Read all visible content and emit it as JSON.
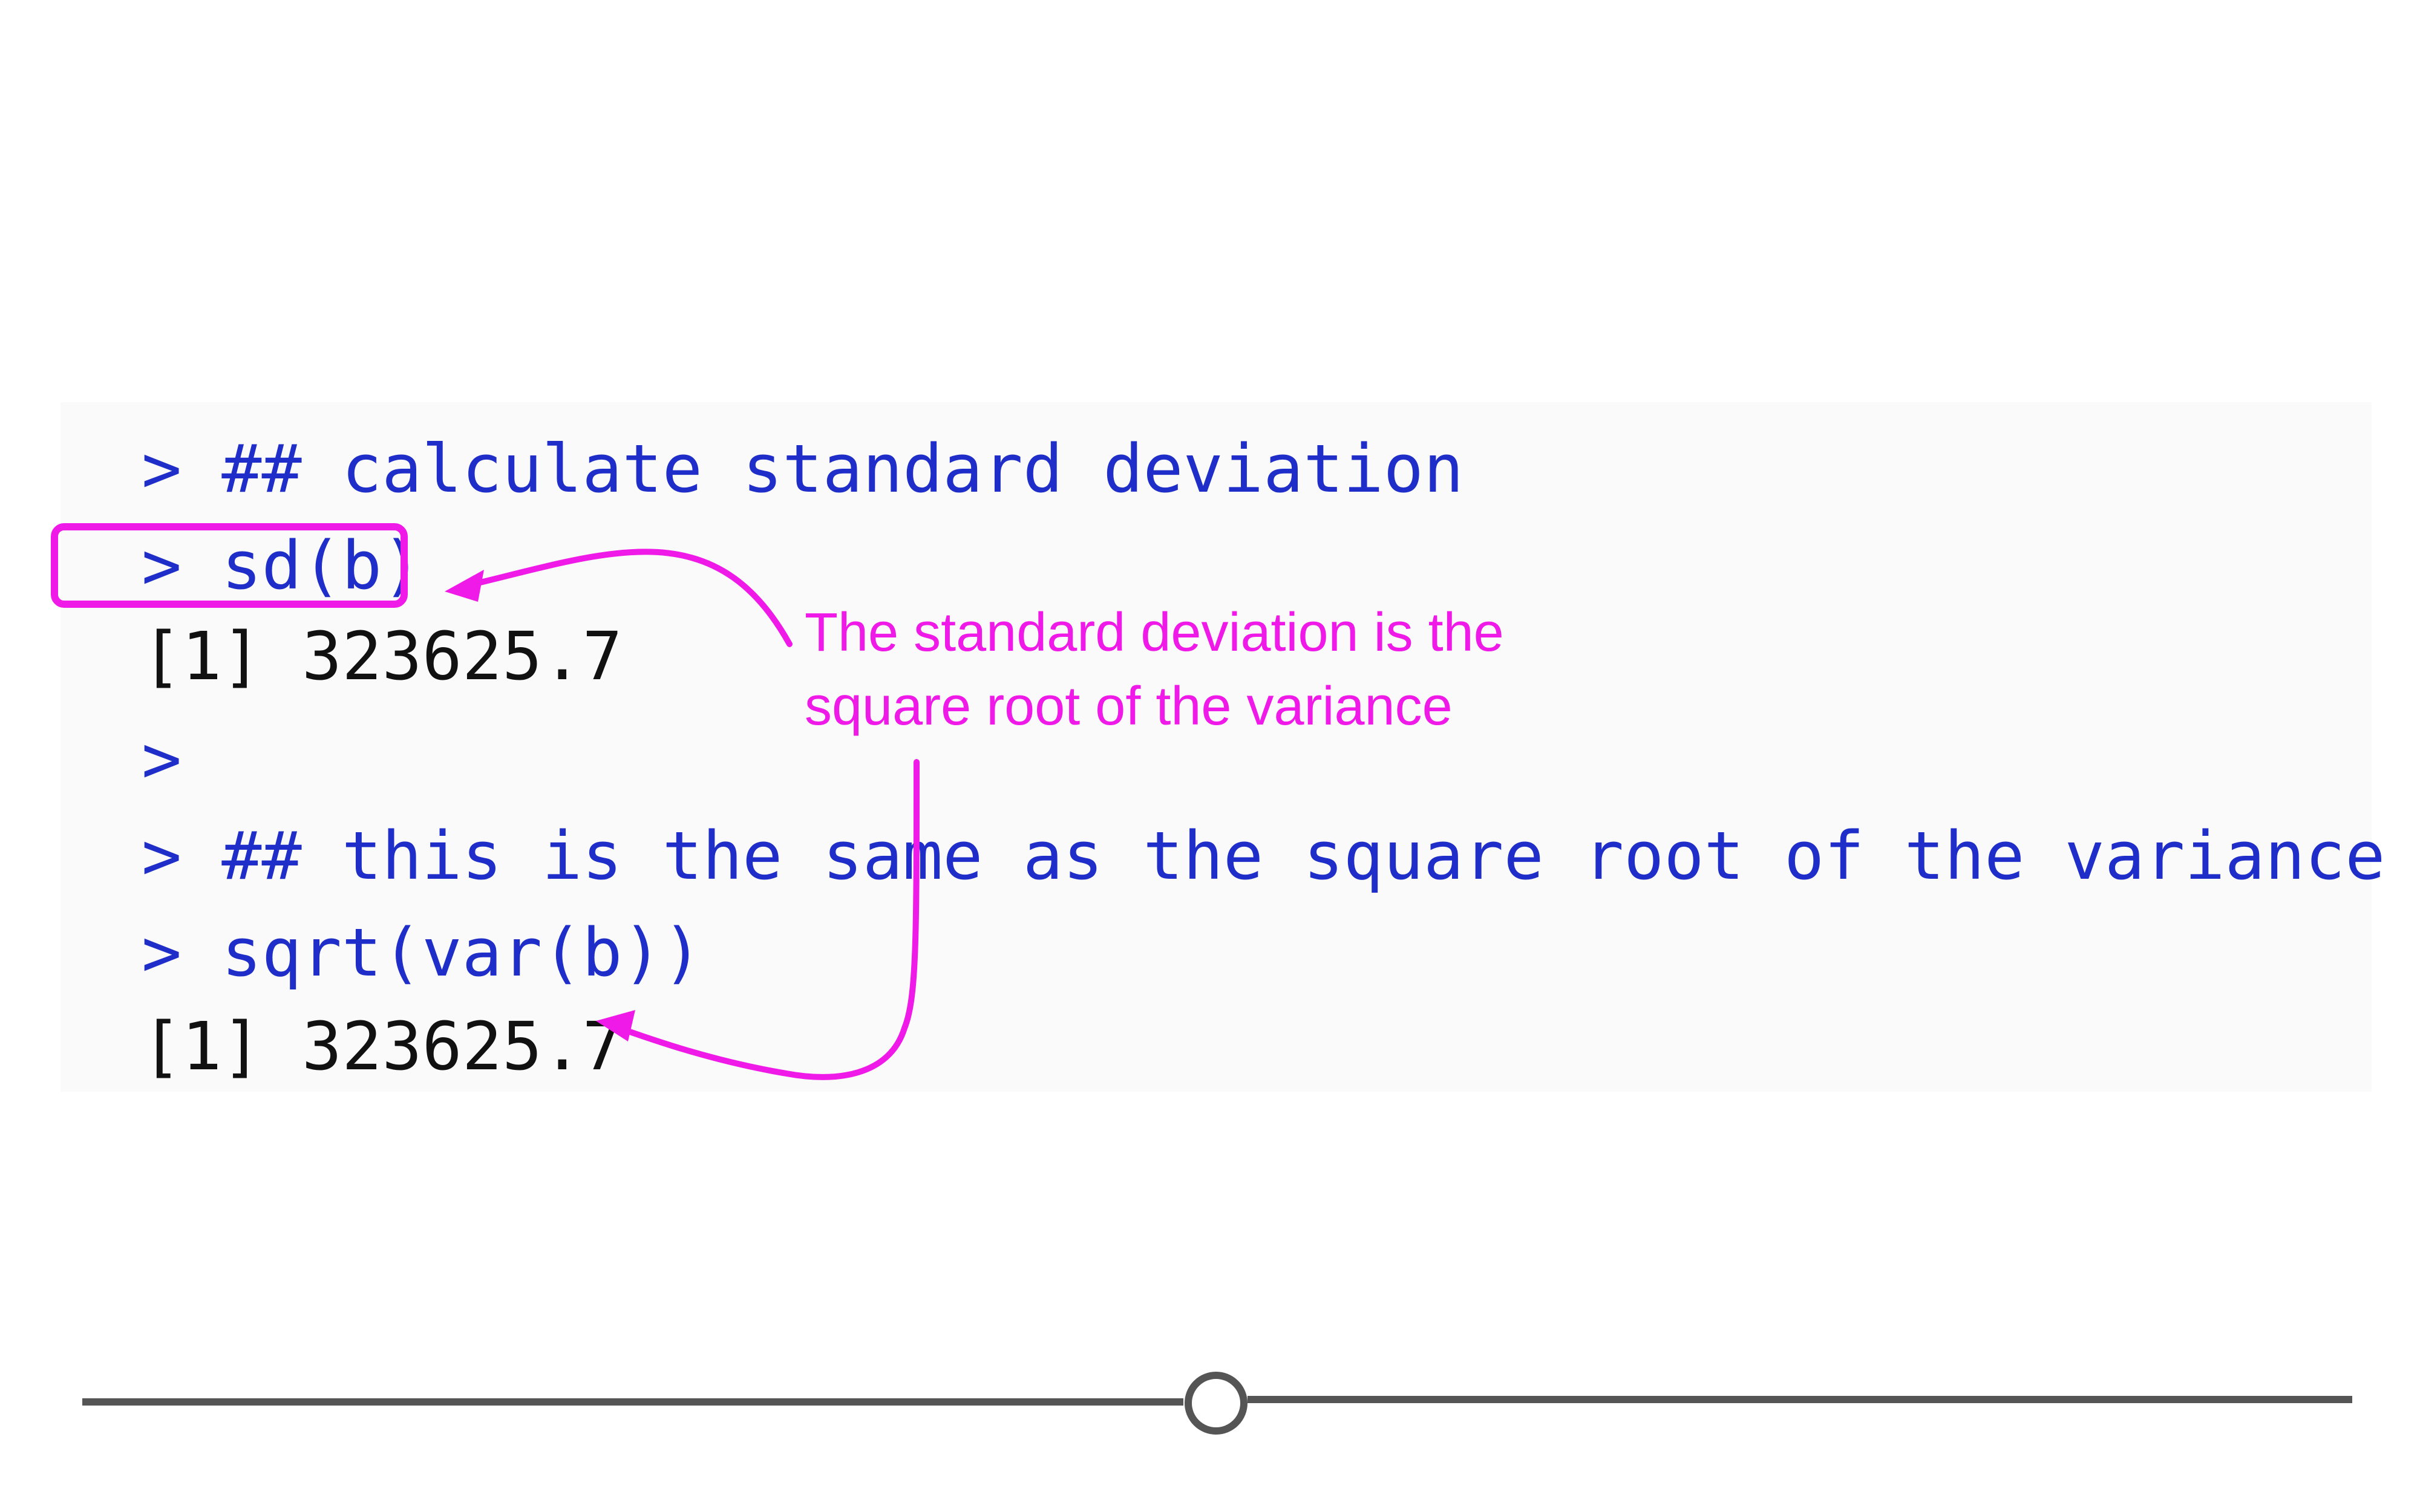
{
  "console": {
    "lines": [
      {
        "kind": "input",
        "prompt": ">",
        "text": "## calculate standard deviation"
      },
      {
        "kind": "input",
        "prompt": ">",
        "text": "sd(b)"
      },
      {
        "kind": "output",
        "text": "[1] 323625.7"
      },
      {
        "kind": "input",
        "prompt": ">",
        "text": ""
      },
      {
        "kind": "input",
        "prompt": ">",
        "text": "## this is the same as the square root of the variance"
      },
      {
        "kind": "input",
        "prompt": ">",
        "text": "sqrt(var(b))"
      },
      {
        "kind": "output",
        "text": "[1] 323625.7"
      }
    ]
  },
  "annotation": {
    "line1": "The standard deviation is the",
    "line2": "square root of the variance",
    "color": "#f01ae8"
  },
  "colors": {
    "input_text": "#1f2ec9",
    "output_text": "#111111",
    "slider": "#555555"
  },
  "slider": {
    "value": 0.5
  }
}
